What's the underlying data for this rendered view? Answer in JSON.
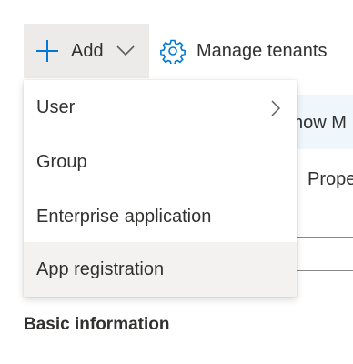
{
  "toolbar": {
    "add_label": "Add",
    "manage_tenants_label": "Manage tenants",
    "icons": {
      "add": "plus-icon",
      "add_dropdown": "chevron-down-icon",
      "manage_tenants": "gear-icon"
    },
    "accent_color": "#0078d4"
  },
  "add_menu": {
    "items": [
      {
        "label": "User",
        "has_submenu": true
      },
      {
        "label": "Group"
      },
      {
        "label": "Enterprise application"
      },
      {
        "label": "App registration",
        "hovered": true
      }
    ]
  },
  "background": {
    "banner_text": "now M",
    "tab_text": "Prope",
    "section_title": "Basic information"
  }
}
